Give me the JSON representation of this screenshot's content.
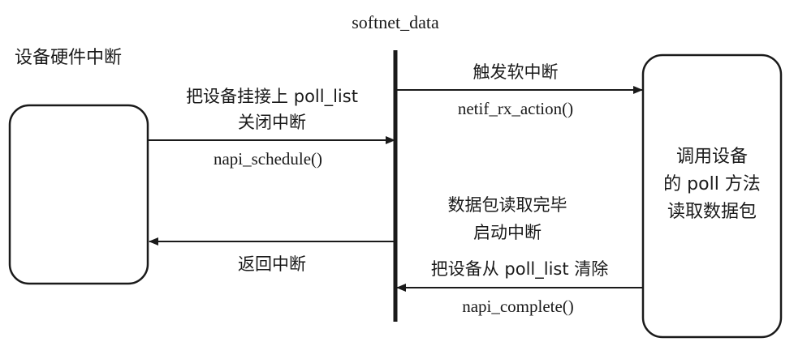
{
  "center_label": "softnet_data",
  "left_title": "设备硬件中断",
  "arrows": {
    "schedule": {
      "line1": "把设备挂接上 poll_list",
      "line2": "关闭中断",
      "func": "napi_schedule()"
    },
    "softirq": {
      "line1": "触发软中断",
      "func": "netif_rx_action()"
    },
    "poll_done": {
      "line1": "数据包读取完毕",
      "line2": "启动中断",
      "line3": "把设备从 poll_list 清除",
      "func": "napi_complete()"
    },
    "return": {
      "line1": "返回中断"
    }
  },
  "right_box": {
    "line1": "调用设备",
    "line2": "的 poll 方法",
    "line3": "读取数据包"
  },
  "colors": {
    "stroke": "#1a1a1a",
    "background": "#ffffff"
  }
}
